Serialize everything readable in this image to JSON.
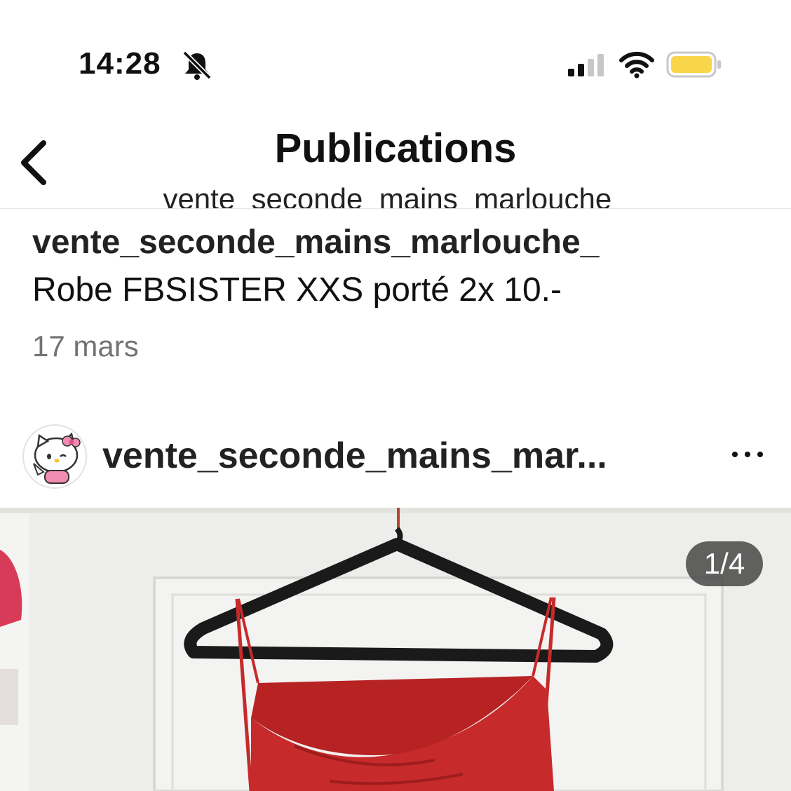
{
  "status_bar": {
    "time": "14:28",
    "icons": [
      "bell-off-icon",
      "cellular-signal-icon",
      "wifi-icon",
      "battery-icon"
    ],
    "battery_color": "#F8D549"
  },
  "header": {
    "title": "Publications",
    "subtitle": "vente_seconde_mains_marlouche_",
    "back_icon": "chevron-left-icon"
  },
  "caption": {
    "username": "vente_seconde_mains_marlouche_",
    "text": "Robe FBSISTER XXS porté 2x 10.-",
    "date": "17 mars"
  },
  "post": {
    "username": "vente_seconde_mains_mar...",
    "more_icon": "more-horizontal-icon",
    "image_counter": "1/4",
    "image_description_colors": {
      "wall": "#ececec",
      "hanger": "#1a1a1a",
      "dress": "#c62a2a"
    }
  }
}
